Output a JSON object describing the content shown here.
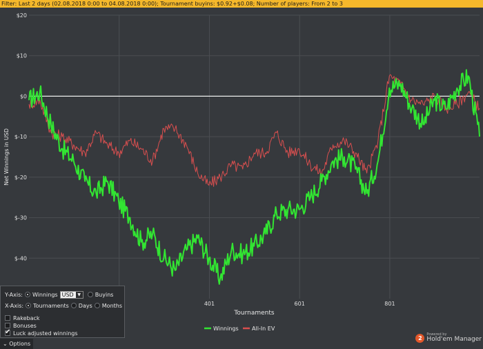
{
  "filter": {
    "text": "Filter: Last 2 days (02.08.2018 0:00 to 04.08.2018 0:00); Tournament buyins: $0.92+$0.08; Number of players: From 2 to 3"
  },
  "options": {
    "y_axis_label": "Y-Axis:",
    "winnings_label": "Winnings",
    "currency_value": "USD",
    "buyins_label": "Buyins",
    "x_axis_label": "X-Axis:",
    "tournaments_label": "Tournaments",
    "days_label": "Days",
    "months_label": "Months",
    "rakeback_label": "Rakeback",
    "bonuses_label": "Bonuses",
    "luck_label": "Luck adjusted winnings",
    "selected_y": "Winnings",
    "selected_x": "Tournaments",
    "luck_checked": true
  },
  "bottom": {
    "options_tab": "Options",
    "brand_badge": "2",
    "powered_by": "Powered by",
    "brand_name": "Hold'em Manager"
  },
  "colors": {
    "winnings": "#32e532",
    "allin_ev": "#d94f4f",
    "zero_line": "#ffffff",
    "filter_bar": "#f5b82b",
    "background": "#36393d"
  },
  "chart_data": {
    "type": "line",
    "title": "",
    "xlabel": "Tournaments",
    "ylabel": "Net Winnings in USD",
    "xlim": [
      1,
      1000
    ],
    "ylim": [
      -50,
      20
    ],
    "y_ticks": [
      20,
      10,
      0,
      -10,
      -20,
      -30,
      -40
    ],
    "y_tick_labels": [
      "$20",
      "$10",
      "$0",
      "$-10",
      "$-20",
      "$-30",
      "$-40"
    ],
    "x_ticks": [
      401,
      601,
      801
    ],
    "x_tick_labels": [
      "401",
      "601",
      "801"
    ],
    "grid": true,
    "legend_position": "bottom-center",
    "x": [
      1,
      25,
      50,
      75,
      100,
      125,
      150,
      175,
      200,
      225,
      250,
      275,
      300,
      325,
      350,
      375,
      400,
      425,
      450,
      475,
      500,
      525,
      550,
      575,
      600,
      625,
      650,
      675,
      700,
      725,
      750,
      775,
      800,
      825,
      850,
      875,
      900,
      925,
      950,
      975,
      1000
    ],
    "series": [
      {
        "name": "Winnings",
        "values": [
          -1,
          1,
          -7,
          -13,
          -16,
          -21,
          -24,
          -21,
          -26,
          -30,
          -36,
          -34,
          -40,
          -43,
          -38,
          -35,
          -40,
          -45,
          -38,
          -39,
          -37,
          -34,
          -29,
          -28,
          -28,
          -25,
          -21,
          -16,
          -15,
          -18,
          -24,
          -16,
          2,
          3,
          -3,
          -7,
          -1,
          -3,
          2,
          5,
          -10
        ]
      },
      {
        "name": "All-In EV",
        "values": [
          -2,
          -1,
          -9,
          -10,
          -12,
          -14,
          -9,
          -12,
          -14,
          -11,
          -13,
          -16,
          -8,
          -8,
          -12,
          -19,
          -22,
          -20,
          -17,
          -18,
          -14,
          -14,
          -9,
          -14,
          -13,
          -17,
          -19,
          -12,
          -11,
          -14,
          -19,
          -11,
          5,
          3,
          -1,
          -2,
          0,
          -3,
          -2,
          1,
          -3
        ]
      }
    ]
  }
}
